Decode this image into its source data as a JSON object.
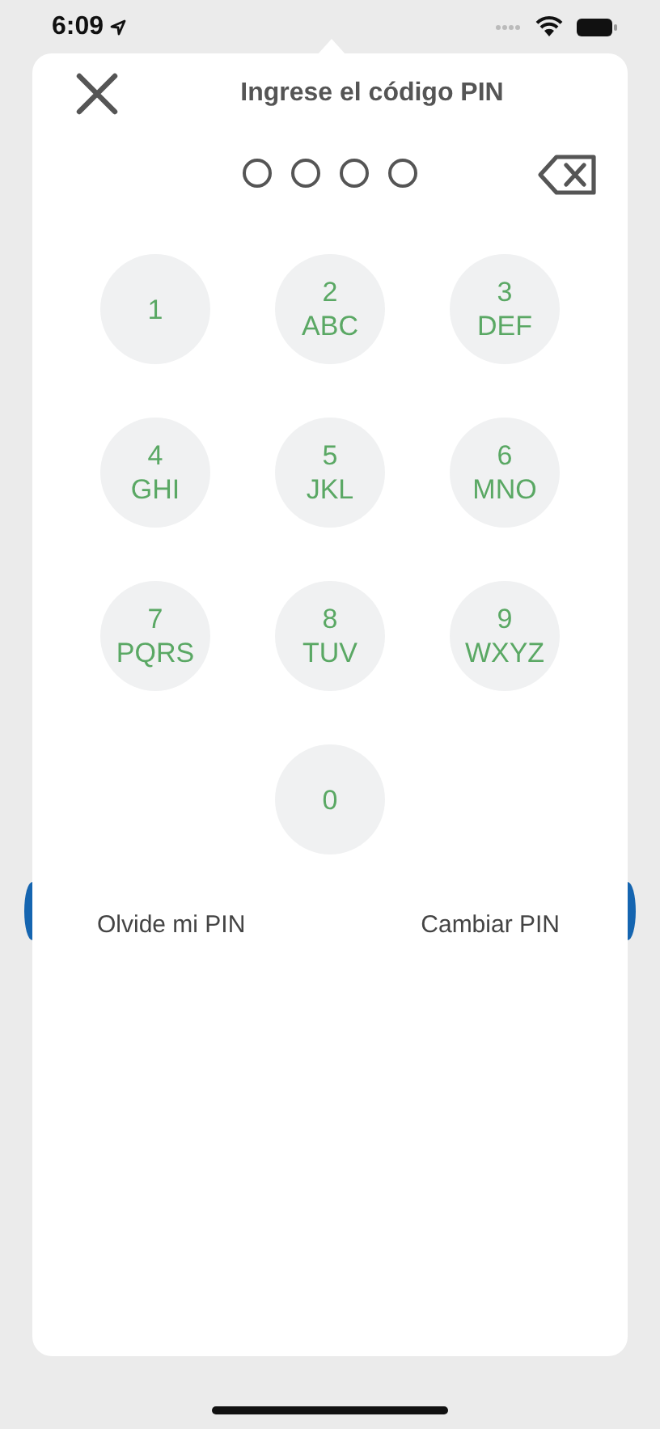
{
  "status_bar": {
    "time": "6:09"
  },
  "title": "Ingrese el código PIN",
  "pin_dots": [
    {
      "filled": false
    },
    {
      "filled": false
    },
    {
      "filled": false
    },
    {
      "filled": false
    }
  ],
  "keys": [
    {
      "digit": "1"
    },
    {
      "digit": "2",
      "letters": "ABC"
    },
    {
      "digit": "3",
      "letters": "DEF"
    },
    {
      "digit": "4",
      "letters": "GHI"
    },
    {
      "digit": "5",
      "letters": "JKL"
    },
    {
      "digit": "6",
      "letters": "MNO"
    },
    {
      "digit": "7",
      "letters": "PQRS"
    },
    {
      "digit": "8",
      "letters": "TUV"
    },
    {
      "digit": "9",
      "letters": "WXYZ"
    },
    {
      "digit": "0"
    }
  ],
  "links": [
    "Olvide mi PIN",
    "Cambiar PIN"
  ]
}
